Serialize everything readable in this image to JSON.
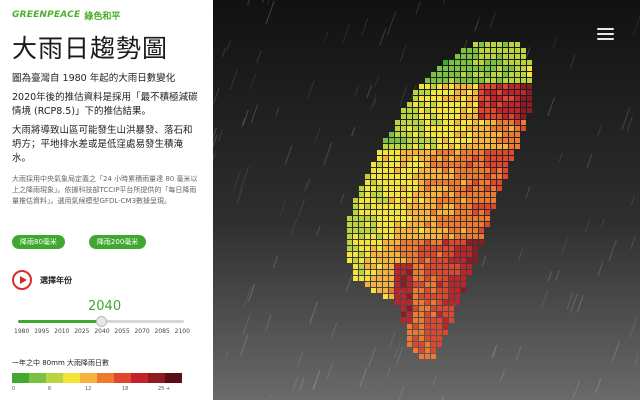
{
  "header": {
    "logo_en": "GREENPEACE",
    "logo_zh": "綠色和平"
  },
  "title": "大雨日趨勢圖",
  "paragraphs": [
    "圖為臺灣自 1980 年起的大雨日數變化",
    "2020年後的推估資料是採用「最不積極減碳情境 (RCP8.5)」下的推估結果。",
    "大雨將導致山區可能發生山洪暴發、落石和坍方；平地排水差或是低窪處易發生積淹水。"
  ],
  "note": "大雨採用中央氣象局定義之「24 小時累積雨量達 80 毫米以上之降雨現象」。依據科技部TCCIP平台所提供的「每日降雨量推估資料」。選用氣候模型GFDL-CM3數據呈現。",
  "buttons": {
    "rain80": "降雨80毫米",
    "rain200": "降雨200毫米"
  },
  "player": {
    "label": "選擇年份",
    "selected_year": "2040",
    "selected_fraction": 0.5,
    "ticks": [
      "1980",
      "1995",
      "2010",
      "2025",
      "2040",
      "2055",
      "2070",
      "2085",
      "2100"
    ]
  },
  "legend": {
    "title": "一年之中 80mm 大雨降雨日數",
    "labels": [
      "0",
      "6",
      "12",
      "18",
      "25 +"
    ],
    "colors": [
      "#3faa2e",
      "#7cc242",
      "#b9d43f",
      "#f4e43a",
      "#f6b23a",
      "#ee7a30",
      "#e0462b",
      "#c2232b",
      "#8e1a22",
      "#5a0f16"
    ]
  },
  "map": {
    "icon": "hamburger-menu-icon"
  }
}
